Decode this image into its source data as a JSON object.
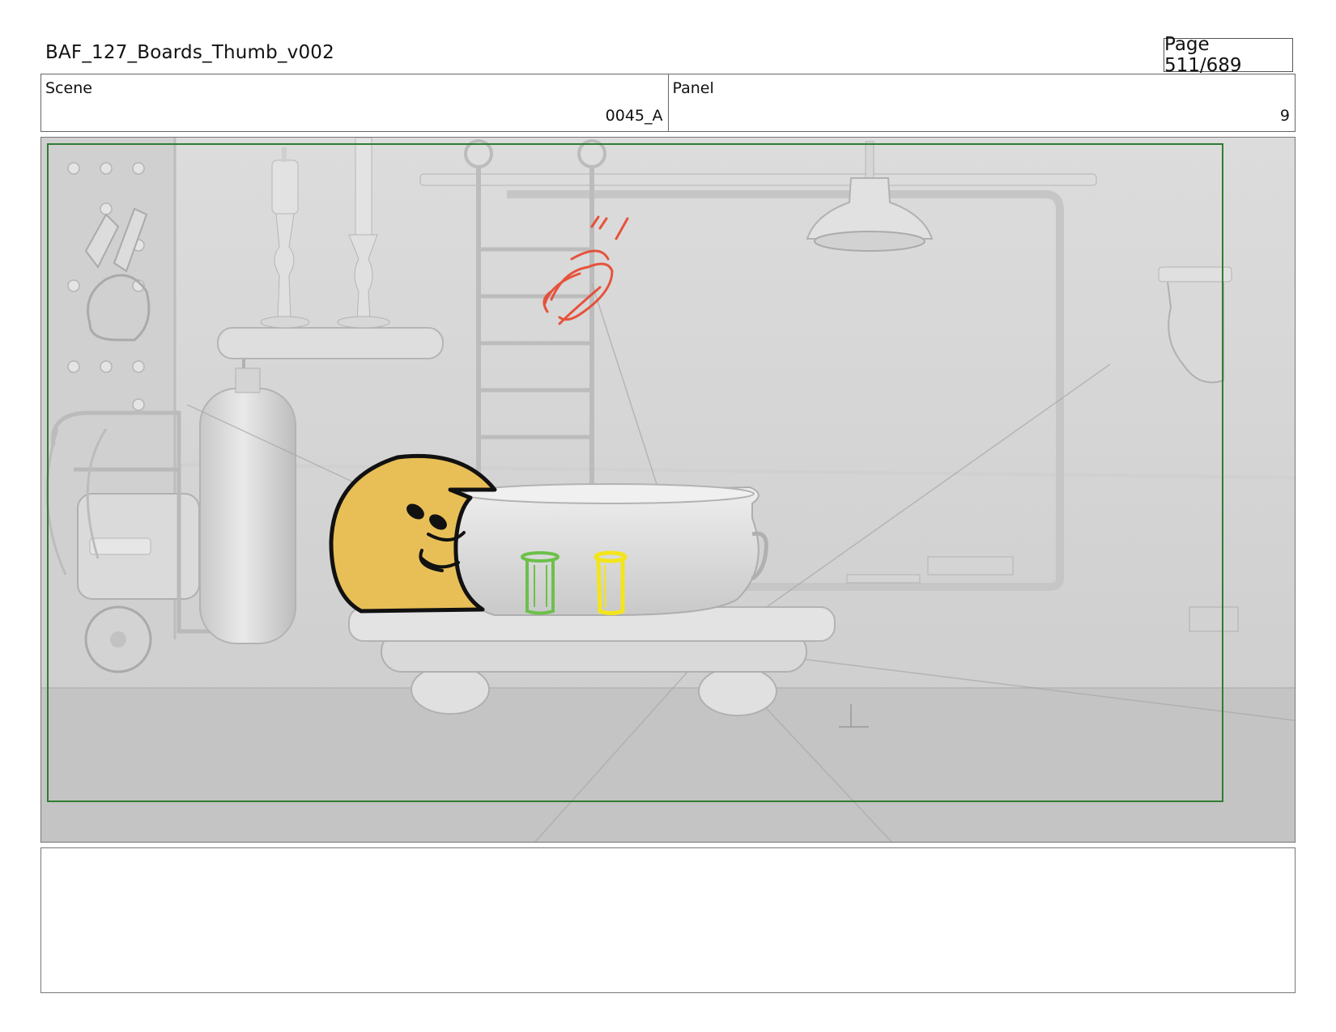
{
  "header": {
    "document_title": "BAF_127_Boards_Thumb_v002",
    "page_label": "Page 511/689"
  },
  "info": {
    "scene_label": "Scene",
    "scene_value": "0045_A",
    "panel_label": "Panel",
    "panel_value": "9"
  },
  "notes": {
    "text": ""
  },
  "colors": {
    "safe_frame": "#2f7d32",
    "character_fill": "#e8bf57",
    "green_jar": "#6cc04a",
    "yellow_jar": "#f3e51c",
    "red_sketch": "#e8452c"
  }
}
